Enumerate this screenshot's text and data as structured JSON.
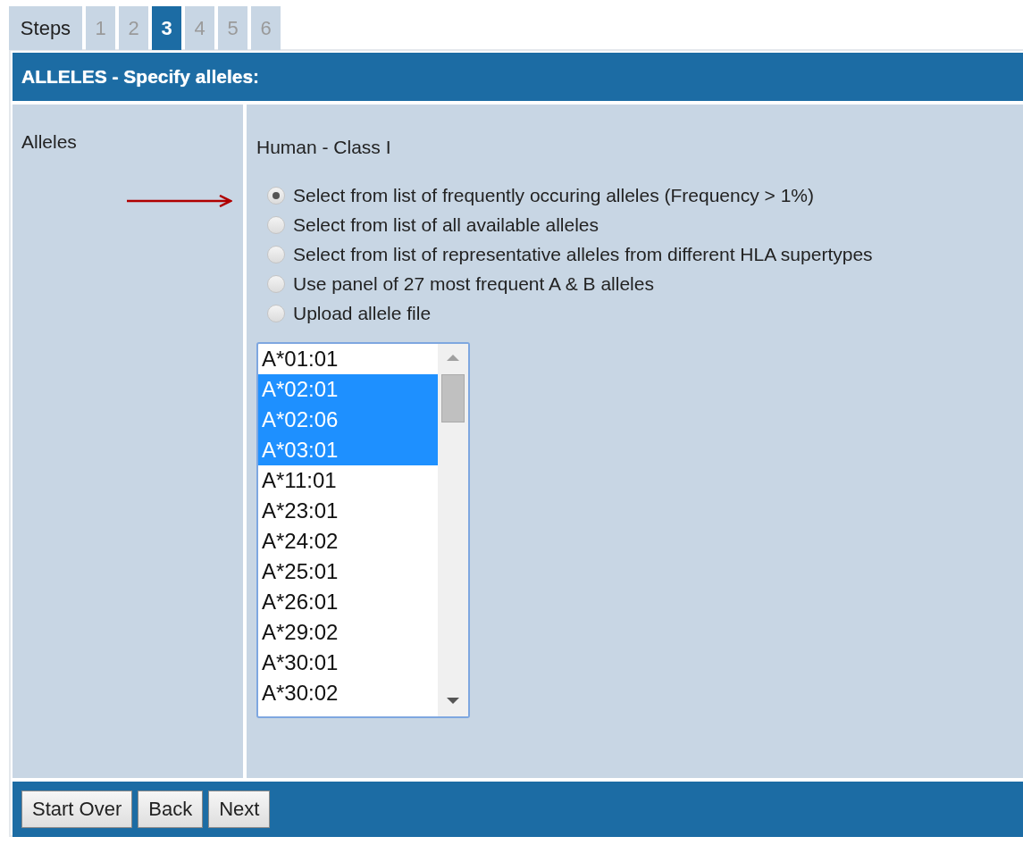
{
  "steps": {
    "label": "Steps",
    "items": [
      {
        "label": "1",
        "selected": false
      },
      {
        "label": "2",
        "selected": false
      },
      {
        "label": "3",
        "selected": true
      },
      {
        "label": "4",
        "selected": false
      },
      {
        "label": "5",
        "selected": false
      },
      {
        "label": "6",
        "selected": false
      }
    ]
  },
  "panel": {
    "title": "ALLELES - Specify alleles:",
    "field_label": "Alleles",
    "species": "Human - Class I",
    "options": [
      {
        "label": "Select from list of frequently occuring alleles (Frequency > 1%)",
        "selected": true
      },
      {
        "label": "Select from list of all available alleles",
        "selected": false
      },
      {
        "label": "Select from list of representative alleles from different HLA supertypes",
        "selected": false
      },
      {
        "label": "Use panel of 27 most frequent A & B alleles",
        "selected": false
      },
      {
        "label": "Upload allele file",
        "selected": false
      }
    ],
    "alleles": [
      {
        "label": "A*01:01",
        "selected": false
      },
      {
        "label": "A*02:01",
        "selected": true
      },
      {
        "label": "A*02:06",
        "selected": true
      },
      {
        "label": "A*03:01",
        "selected": true
      },
      {
        "label": "A*11:01",
        "selected": false
      },
      {
        "label": "A*23:01",
        "selected": false
      },
      {
        "label": "A*24:02",
        "selected": false
      },
      {
        "label": "A*25:01",
        "selected": false
      },
      {
        "label": "A*26:01",
        "selected": false
      },
      {
        "label": "A*29:02",
        "selected": false
      },
      {
        "label": "A*30:01",
        "selected": false
      },
      {
        "label": "A*30:02",
        "selected": false
      }
    ]
  },
  "buttons": [
    "Start Over",
    "Back",
    "Next"
  ]
}
